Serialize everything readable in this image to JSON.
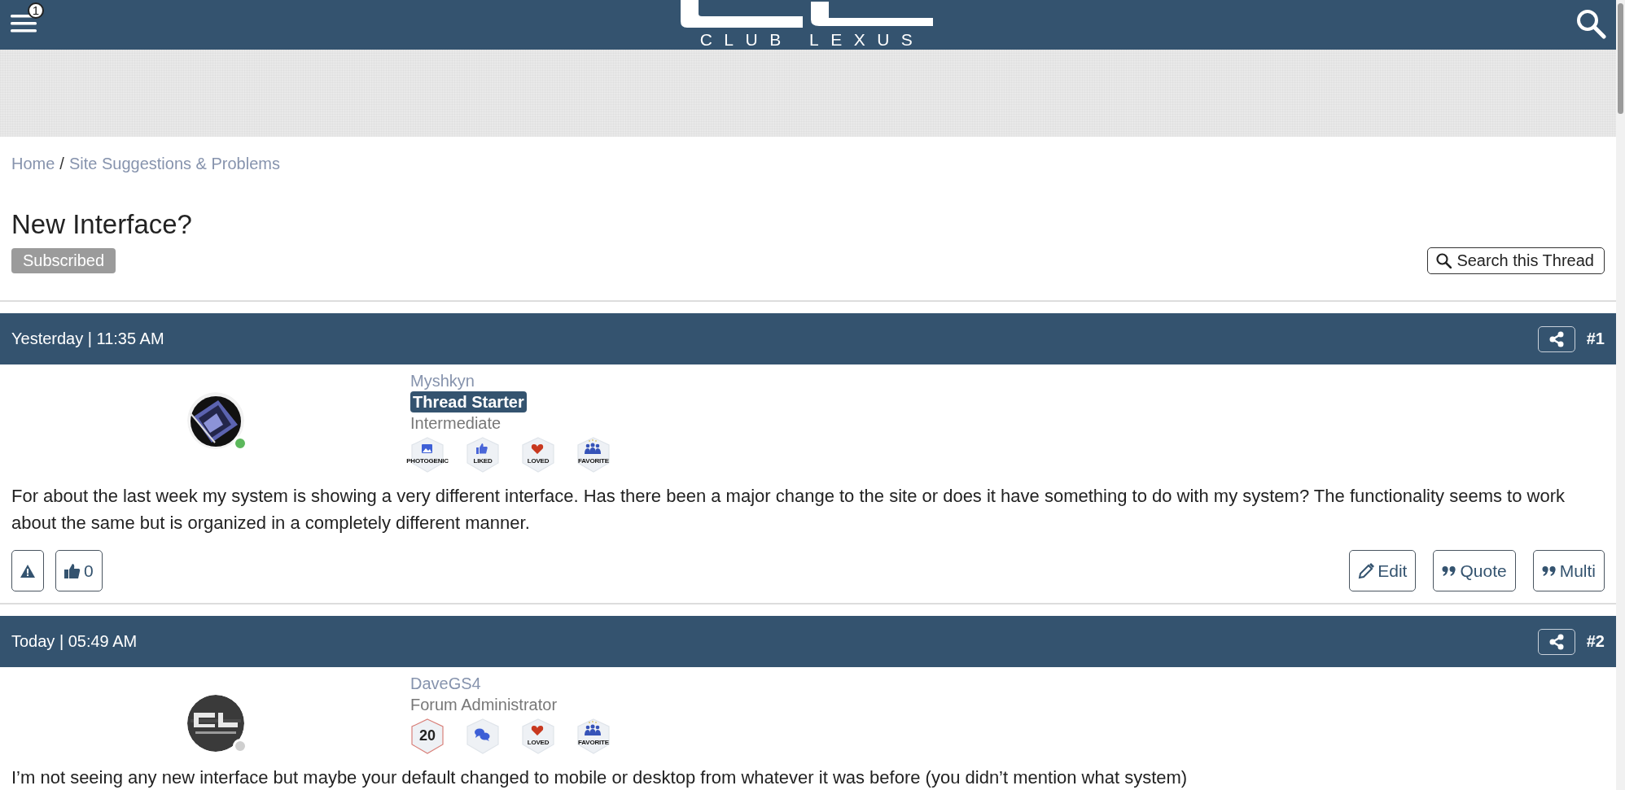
{
  "header": {
    "menu_badge": "1",
    "logo_text": "CLUB LEXUS"
  },
  "breadcrumb": [
    {
      "label": "Home"
    },
    {
      "label": "Site Suggestions & Problems"
    }
  ],
  "breadcrumb_separator": "/",
  "thread": {
    "title": "New Interface?",
    "subscribed_label": "Subscribed",
    "search_label": "Search this Thread"
  },
  "posts": [
    {
      "date": "Yesterday | 11:35 AM",
      "number": "#1",
      "online": true,
      "avatar": {
        "kind": "picture"
      },
      "username": "Myshkyn",
      "tag": "Thread Starter",
      "rank": "Intermediate",
      "badges": [
        {
          "label": "PHOTOGENIC"
        },
        {
          "kind": "like",
          "label": "LIKED"
        },
        {
          "kind": "heart",
          "label": "LOVED"
        },
        {
          "kind": "group",
          "label": "FAVORITE"
        }
      ],
      "body": "For about the last week my system is showing a very different interface. Has there been a major change to the site or does it have something to do with my system? The functionality seems to work about the same but is organized in a completely different manner.",
      "like_count": "0",
      "actions": [
        {
          "kind": "edit",
          "label": "Edit"
        },
        {
          "kind": "quote",
          "label": "Quote"
        },
        {
          "kind": "quote",
          "label": "Multi"
        }
      ]
    },
    {
      "date": "Today | 05:49 AM",
      "number": "#2",
      "online": false,
      "avatar": {
        "kind": "picture"
      },
      "username": "DaveGS4",
      "rank": "Forum Administrator",
      "badges": [
        {
          "kind": "count",
          "label": "20"
        },
        {
          "kind": "chat"
        },
        {
          "kind": "heart",
          "label": "LOVED"
        },
        {
          "kind": "group",
          "label": "FAVORITE"
        }
      ],
      "body": "I’m not seeing any new interface but maybe your default changed to mobile or desktop from whatever it was before (you didn’t mention what system)"
    }
  ]
}
